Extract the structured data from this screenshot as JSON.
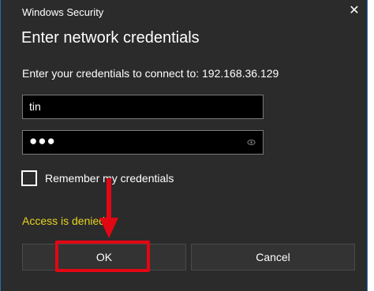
{
  "window": {
    "title": "Windows Security"
  },
  "dialog": {
    "heading": "Enter network credentials",
    "prompt": "Enter your credentials to connect to: 192.168.36.129"
  },
  "fields": {
    "username_value": "tin",
    "password_value": "●●●"
  },
  "checkbox": {
    "label": "Remember my credentials",
    "checked": false
  },
  "status": {
    "error": "Access is denied."
  },
  "buttons": {
    "ok": "OK",
    "cancel": "Cancel"
  },
  "icons": {
    "close": "close-icon",
    "reveal": "eye-icon",
    "annotation": "arrow-down-icon"
  },
  "colors": {
    "dialog_background": "#2b2b2b",
    "field_background": "#000000",
    "error_text": "#e8d320",
    "annotation_red": "#e30613"
  }
}
